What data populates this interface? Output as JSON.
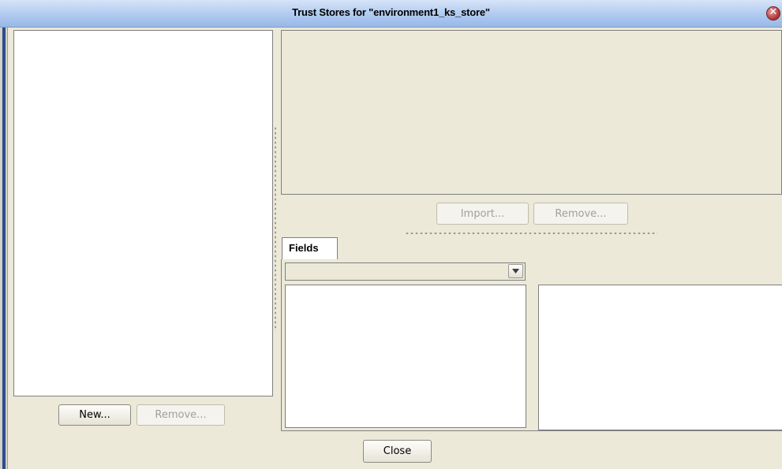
{
  "window": {
    "title": "Trust Stores for \"environment1_ks_store\"",
    "close_icon": "close-icon",
    "accent_color": "#2b4d8c"
  },
  "left_panel": {
    "new_label": "New...",
    "remove_label": "Remove..."
  },
  "right_panel": {
    "import_label": "Import...",
    "remove_label": "Remove...",
    "tabs": [
      {
        "label": "Fields",
        "selected": true
      }
    ],
    "fields_select_value": ""
  },
  "footer": {
    "close_label": "Close"
  }
}
